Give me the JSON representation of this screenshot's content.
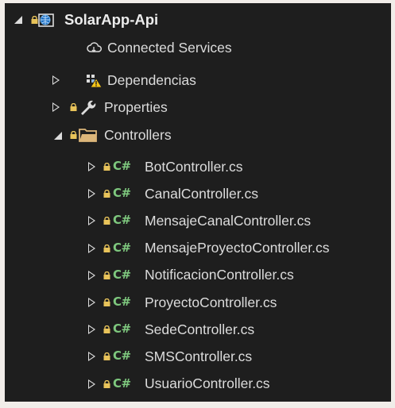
{
  "colors": {
    "panel_bg": "#1e1e1e",
    "text": "#dcdcdc",
    "accent_green": "#7ec87e",
    "folder": "#dcb67a",
    "lock": "#e8c35a"
  },
  "tree": {
    "root": {
      "label": "SolarApp-Api",
      "icon": "web-project-icon"
    },
    "items": [
      {
        "label": "Connected Services",
        "icon": "connected-services-icon"
      },
      {
        "label": "Dependencias",
        "icon": "dependencies-warning-icon"
      },
      {
        "label": "Properties",
        "icon": "wrench-icon"
      },
      {
        "label": "Controllers",
        "icon": "folder-icon"
      }
    ],
    "cs_badge": "C#",
    "files": [
      {
        "label": "BotController.cs"
      },
      {
        "label": "CanalController.cs"
      },
      {
        "label": "MensajeCanalController.cs"
      },
      {
        "label": "MensajeProyectoController.cs"
      },
      {
        "label": "NotificacionController.cs"
      },
      {
        "label": "ProyectoController.cs"
      },
      {
        "label": "SedeController.cs"
      },
      {
        "label": "SMSController.cs"
      },
      {
        "label": "UsuarioController.cs"
      }
    ]
  }
}
